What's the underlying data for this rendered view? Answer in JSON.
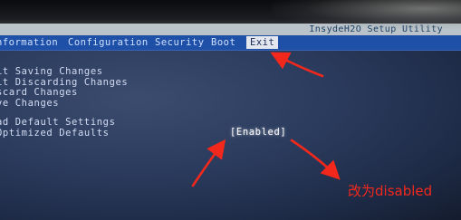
{
  "bios": {
    "title": "InsydeH2O Setup Utility",
    "menu": [
      {
        "label": "nformation"
      },
      {
        "label": "Configuration"
      },
      {
        "label": "Security"
      },
      {
        "label": "Boot"
      },
      {
        "label": "Exit",
        "selected": true
      }
    ],
    "options": [
      {
        "label": "it Saving Changes"
      },
      {
        "label": "it Discarding Changes"
      },
      {
        "label": "scard Changes"
      },
      {
        "label": "ve Changes"
      },
      {
        "label": "ad Default Settings"
      },
      {
        "label": "Optimized Defaults",
        "value": "[Enabled]"
      }
    ]
  },
  "annotation": {
    "text": "改为disabled",
    "color": "#f3281c"
  },
  "colors": {
    "menu_bar": "#1f50a8",
    "selected_tab_bg": "#e4e8ee",
    "annotation_arrow": "#f3281c",
    "background": "#2a3a5c"
  },
  "icons": [
    "red-arrow-icon"
  ]
}
